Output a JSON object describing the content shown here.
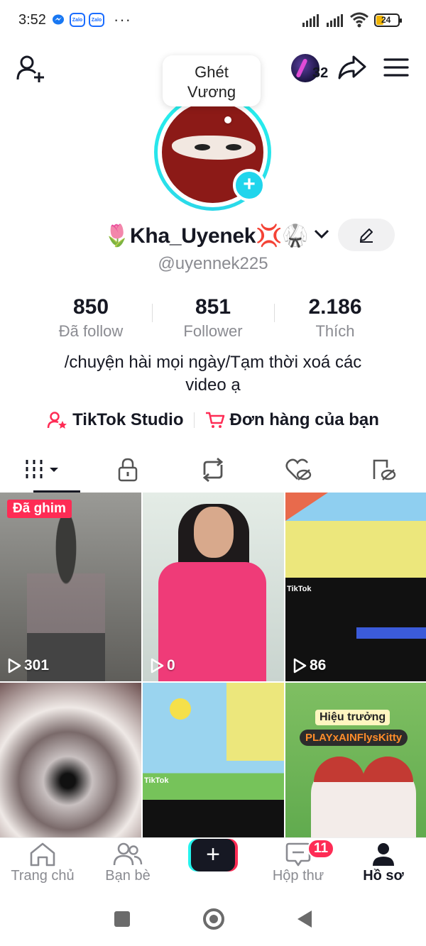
{
  "status_bar": {
    "time": "3:52",
    "battery": "24",
    "zalo_label": "Zalo",
    "dots": "···"
  },
  "header": {
    "mini_avatar_count": "32"
  },
  "bubble": {
    "text_line1": "Ghét",
    "text_line2": "Vương"
  },
  "profile": {
    "display_name": "🌷Kha_Uyenek💢🥋",
    "username": "@uyennek225",
    "bio_line1": "/chuyện hài mọi ngày/Tạm thời xoá các",
    "bio_line2": "video ạ"
  },
  "stats": [
    {
      "value": "850",
      "label": "Đã follow"
    },
    {
      "value": "851",
      "label": "Follower"
    },
    {
      "value": "2.186",
      "label": "Thích"
    }
  ],
  "links": {
    "studio": "TikTok Studio",
    "orders": "Đơn hàng của bạn"
  },
  "videos": [
    {
      "views": "301",
      "pinned_label": "Đã ghim"
    },
    {
      "views": "0"
    },
    {
      "views": "86"
    },
    {
      "views": ""
    },
    {
      "views": ""
    },
    {
      "views": ""
    }
  ],
  "video_overlays": {
    "tiktok_watermark": "TikTok",
    "tag_title": "Hiệu trưởng",
    "tag_sub": "PLAYxAINFlysKitty"
  },
  "bottom_nav": {
    "home": "Trang chủ",
    "friends": "Bạn bè",
    "create": "+",
    "inbox": "Hộp thư",
    "inbox_badge": "11",
    "profile": "Hồ sơ"
  },
  "colors": {
    "accent": "#fe2c55",
    "cyan": "#25f4ee",
    "text_secondary": "#8a8b91"
  }
}
